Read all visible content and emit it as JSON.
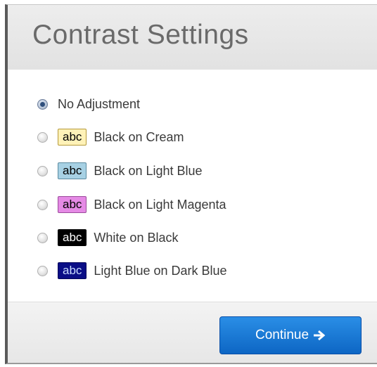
{
  "dialog": {
    "title": "Contrast Settings",
    "options": [
      {
        "label": "No Adjustment",
        "selected": true,
        "swatch": null
      },
      {
        "label": "Black on Cream",
        "selected": false,
        "swatch": {
          "text": "abc",
          "fg": "#000000",
          "bg": "#fff2b8"
        }
      },
      {
        "label": "Black on Light Blue",
        "selected": false,
        "swatch": {
          "text": "abc",
          "fg": "#000000",
          "bg": "#a7d1e4"
        }
      },
      {
        "label": "Black on Light Magenta",
        "selected": false,
        "swatch": {
          "text": "abc",
          "fg": "#000000",
          "bg": "#e58ae5"
        }
      },
      {
        "label": "White on Black",
        "selected": false,
        "swatch": {
          "text": "abc",
          "fg": "#ffffff",
          "bg": "#000000"
        }
      },
      {
        "label": "Light Blue on Dark Blue",
        "selected": false,
        "swatch": {
          "text": "abc",
          "fg": "#c9dcff",
          "bg": "#0a0e86"
        }
      }
    ],
    "continue_label": "Continue",
    "continue_icon": "arrow-right-icon",
    "colors": {
      "accent": "#1a7ad8",
      "header_bg": "#e8e8e8",
      "title_text": "#6a6a6a"
    }
  }
}
